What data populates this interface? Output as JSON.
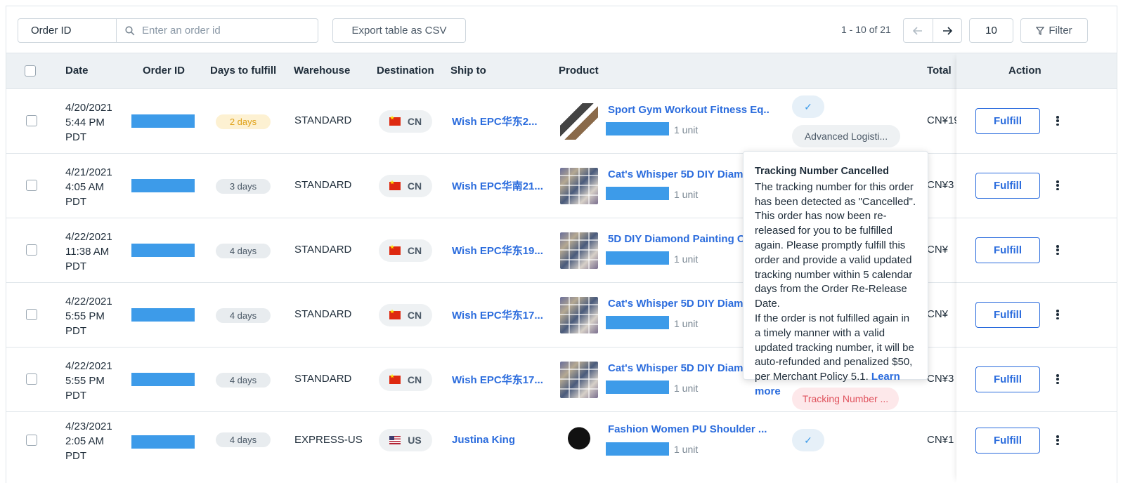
{
  "toolbar": {
    "search_type": "Order ID",
    "search_placeholder": "Enter an order id",
    "export_label": "Export table as CSV",
    "page_range": "1 - 10 of 21",
    "page_size": "10",
    "filter_label": "Filter"
  },
  "table": {
    "headers": {
      "date": "Date",
      "order_id": "Order ID",
      "days": "Days to fulfill",
      "warehouse": "Warehouse",
      "destination": "Destination",
      "ship_to": "Ship to",
      "product": "Product",
      "total": "Total",
      "action": "Action"
    },
    "fulfill_label": "Fulfill",
    "rows": [
      {
        "date1": "4/20/2021",
        "date2": "5:44 PM",
        "date3": "PDT",
        "days": "2 days",
        "warehouse": "STANDARD",
        "dest": "CN",
        "ship_to": "Wish EPC华东2...",
        "product": "Sport Gym Workout Fitness Eq...",
        "unit": "1 unit",
        "status": "Advanced Logisti...",
        "total": "CN¥19"
      },
      {
        "date1": "4/21/2021",
        "date2": "4:05 AM",
        "date3": "PDT",
        "days": "3 days",
        "warehouse": "STANDARD",
        "dest": "CN",
        "ship_to": "Wish EPC华南21...",
        "product": "Cat's Whisper 5D DIY Diamo",
        "unit": "1 unit",
        "total": "CN¥3"
      },
      {
        "date1": "4/22/2021",
        "date2": "11:38 AM",
        "date3": "PDT",
        "days": "4 days",
        "warehouse": "STANDARD",
        "dest": "CN",
        "ship_to": "Wish EPC华东19...",
        "product": "5D DIY Diamond Painting C",
        "unit": "1 unit",
        "total": "CN¥"
      },
      {
        "date1": "4/22/2021",
        "date2": "5:55 PM",
        "date3": "PDT",
        "days": "4 days",
        "warehouse": "STANDARD",
        "dest": "CN",
        "ship_to": "Wish EPC华东17...",
        "product": "Cat's Whisper 5D DIY Diame",
        "unit": "1 unit",
        "total": "CN¥"
      },
      {
        "date1": "4/22/2021",
        "date2": "5:55 PM",
        "date3": "PDT",
        "days": "4 days",
        "warehouse": "STANDARD",
        "dest": "CN",
        "ship_to": "Wish EPC华东17...",
        "product": "Cat's Whisper 5D DIY Diame",
        "unit": "1 unit",
        "status": "Tracking Number ...",
        "total": "CN¥3"
      },
      {
        "date1": "4/23/2021",
        "date2": "2:05 AM",
        "date3": "PDT",
        "days": "4 days",
        "warehouse": "EXPRESS-US",
        "dest": "US",
        "ship_to": "Justina King",
        "product": "Fashion Women PU Shoulder ...",
        "unit": "1 unit",
        "total": "CN¥1"
      }
    ]
  },
  "tooltip": {
    "title": "Tracking Number Cancelled",
    "body1": "The tracking number for this order has been detected as \"Cancelled\". This order has now been re-released for you to be fulfilled again. Please promptly fulfill this order and provide a valid updated tracking number within 5 calendar days from the Order Re-Release Date.",
    "body2": "If the order is not fulfilled again in a timely manner with a valid updated tracking number, it will be auto-refunded and penalized $50, per Merchant Policy 5.1.",
    "link": "Learn more"
  },
  "colors": {
    "accent": "#2b6cdd",
    "redaction": "#3d9be9",
    "warning": "#e0a21a",
    "danger": "#e0525d"
  }
}
